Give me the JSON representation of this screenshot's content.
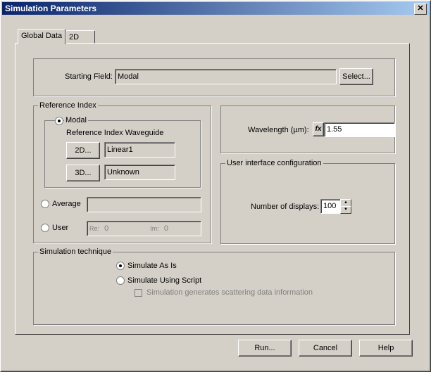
{
  "window": {
    "title": "Simulation Parameters",
    "close_glyph": "✕"
  },
  "tabs": [
    {
      "label": "Global Data",
      "active": true
    },
    {
      "label": "2D",
      "active": false
    }
  ],
  "starting_field": {
    "label": "Starting Field:",
    "value": "Modal",
    "select_label": "Select..."
  },
  "reference_index": {
    "legend": "Reference Index",
    "modal": {
      "label": "Modal",
      "selected": true
    },
    "waveguide_label": "Reference Index Waveguide",
    "btn_2d": "2D...",
    "value_2d": "Linear1",
    "btn_3d": "3D...",
    "value_3d": "Unknown",
    "average": {
      "label": "Average",
      "value": ""
    },
    "user": {
      "label": "User",
      "re_label": "Re:",
      "re_value": "0",
      "im_label": "Im:",
      "im_value": "0"
    }
  },
  "wavelength": {
    "label": "Wavelength (µm):",
    "fx": "fx",
    "value": "1.55"
  },
  "ui_config": {
    "legend": "User interface configuration",
    "label": "Number of displays:",
    "value": "100"
  },
  "technique": {
    "legend": "Simulation technique",
    "as_is": "Simulate As Is",
    "script": "Simulate Using Script",
    "scatter": "Simulation generates scattering data information"
  },
  "buttons": {
    "run": "Run...",
    "cancel": "Cancel",
    "help": "Help"
  }
}
